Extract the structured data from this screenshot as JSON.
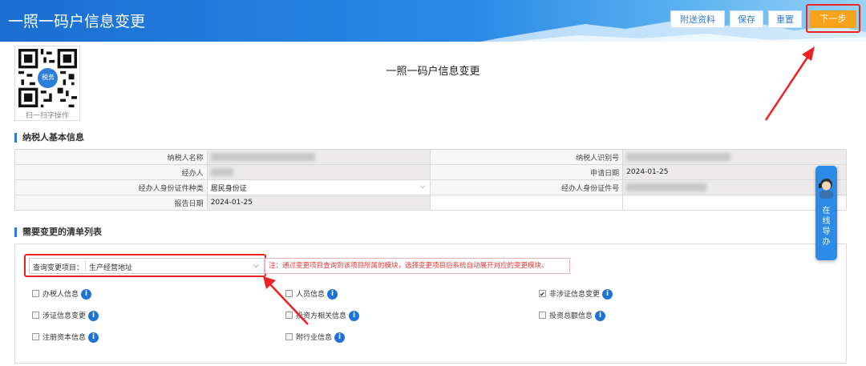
{
  "header": {
    "title": "一照一码户信息变更",
    "buttons": {
      "attach": "附送资料",
      "save": "保存",
      "reset": "重置",
      "next": "下一步"
    }
  },
  "qr": {
    "caption": "扫一扫字操作",
    "center_label": "税务"
  },
  "document": {
    "title": "一照一码户信息变更"
  },
  "taxpayer_section": {
    "title": "纳税人基本信息",
    "rows": [
      {
        "label1": "纳税人名称",
        "value1": "",
        "label2": "纳税人识别号",
        "value2": ""
      },
      {
        "label1": "经办人",
        "value1": "",
        "label2": "申请日期",
        "value2": "2024-01-25"
      },
      {
        "label1": "经办人身份证件种类",
        "value1": "居民身份证",
        "label2": "经办人身份证件号",
        "value2": ""
      },
      {
        "label1": "报告日期",
        "value1": "2024-01-25",
        "label2": "",
        "value2": ""
      }
    ]
  },
  "change_section": {
    "title": "需要变更的清单列表",
    "query_label": "查询变更项目：",
    "query_value": "生产经营地址",
    "note": "注：通过变更项目查询到该项目所属的模块，选择变更项目后系统自动展开对应的变更模块。",
    "checkboxes": [
      {
        "label": "办税人信息",
        "checked": false
      },
      {
        "label": "人员信息",
        "checked": false
      },
      {
        "label": "非涉证信息变更",
        "checked": true
      },
      {
        "label": "涉证信息变更",
        "checked": false
      },
      {
        "label": "投资方相关信息",
        "checked": false
      },
      {
        "label": "投资总额信息",
        "checked": false
      },
      {
        "label": "注册资本信息",
        "checked": false
      },
      {
        "label": "附行业信息",
        "checked": false
      }
    ],
    "info_glyph": "i"
  },
  "guide": {
    "label": "在线导办",
    "icon": "support-avatar-icon"
  },
  "colors": {
    "header_blue": "#1a6fd0",
    "accent_orange": "#f7a21b",
    "highlight_red": "#e22222",
    "info_blue": "#1f72d6"
  }
}
